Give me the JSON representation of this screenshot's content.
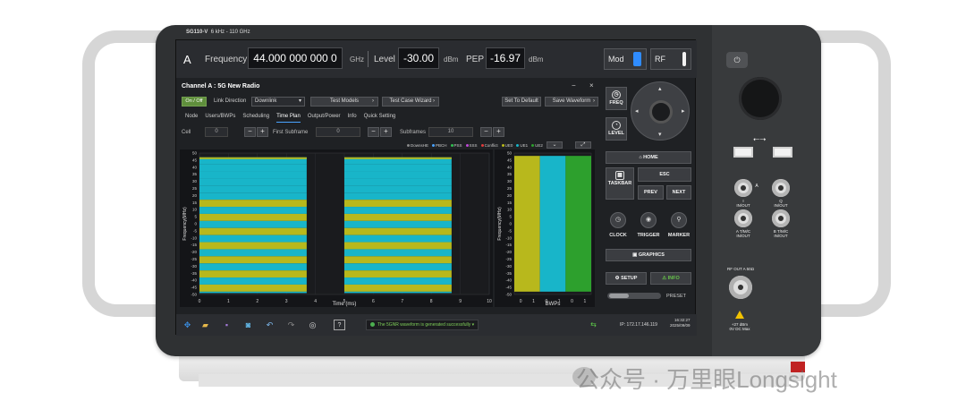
{
  "device": {
    "model": "SG110-V",
    "range": "6 kHz - 110 GHz"
  },
  "topbar": {
    "channel": "A",
    "frequency_label": "Frequency",
    "frequency_value": "44.000 000 000 0",
    "frequency_unit": "GHz",
    "level_label": "Level",
    "level_value": "-30.00",
    "level_unit": "dBm",
    "pep_label": "PEP",
    "pep_value": "-16.97",
    "pep_unit": "dBm",
    "mod_label": "Mod",
    "rf_label": "RF"
  },
  "window": {
    "title": "Channel A : 5G New Radio",
    "minimize": "−",
    "close": "×"
  },
  "controls": {
    "on_off": "On / Off",
    "link_direction_label": "Link Direction",
    "link_direction_value": "Downlink",
    "test_models": "Test Models",
    "test_case_wizard": "Test Case Wizard",
    "set_to_default": "Set To Default",
    "save_waveform": "Save Waveform"
  },
  "tabs": [
    "Node",
    "Users/BWPs",
    "Scheduling",
    "Time Plan",
    "Output/Power",
    "Info",
    "Quick Setting"
  ],
  "active_tab": "Time Plan",
  "row3": {
    "cell_label": "Cell",
    "cell_value": "0",
    "first_subframe_label": "First Subframe",
    "first_subframe_value": "0",
    "subframes_label": "Subframes",
    "subframes_value": "10"
  },
  "legend": [
    {
      "name": "DownsHE",
      "color": "#888888"
    },
    {
      "name": "PBCH",
      "color": "#4aa3ff"
    },
    {
      "name": "PSS",
      "color": "#2fbf4f"
    },
    {
      "name": "SSS",
      "color": "#c049d8"
    },
    {
      "name": "Conflict",
      "color": "#e03c3c"
    },
    {
      "name": "UE0",
      "color": "#b8b81c"
    },
    {
      "name": "UE1",
      "color": "#18b5c9"
    },
    {
      "name": "UE2",
      "color": "#2da02d"
    }
  ],
  "chart_data": [
    {
      "type": "heatmap",
      "title": "",
      "xlabel": "Time (ms)",
      "ylabel": "Frequency(MHz)",
      "xlim": [
        0,
        10
      ],
      "ylim": [
        -50,
        50
      ],
      "x_ticks": [
        "0",
        "1",
        "2",
        "3",
        "4",
        "5",
        "6",
        "7",
        "8",
        "9",
        "10"
      ],
      "y_ticks": [
        "50",
        "45",
        "40",
        "35",
        "30",
        "25",
        "20",
        "15",
        "10",
        "5",
        "0",
        "-5",
        "-10",
        "-15",
        "-20",
        "-25",
        "-30",
        "-35",
        "-40",
        "-45",
        "-50"
      ],
      "blocks": [
        {
          "x_start": 0,
          "x_end": 3.7,
          "y_start": -49,
          "y_end": 47
        },
        {
          "x_start": 5,
          "x_end": 8.7,
          "y_start": -49,
          "y_end": 47
        }
      ],
      "stripe_colors": [
        "#18b5c9",
        "#b8b81c"
      ]
    },
    {
      "type": "bar",
      "xlabel": "BWPs",
      "ylabel": "Frequency(MHz)",
      "ylim": [
        -50,
        50
      ],
      "x_ticks": [
        "0",
        "1",
        "0",
        "1",
        "0",
        "1"
      ],
      "y_ticks": [
        "50",
        "45",
        "40",
        "35",
        "30",
        "25",
        "20",
        "15",
        "10",
        "5",
        "0",
        "-5",
        "-10",
        "-15",
        "-20",
        "-25",
        "-30",
        "-35",
        "-40",
        "-45",
        "-50"
      ],
      "series": [
        {
          "name": "UE0",
          "color": "#b8b81c",
          "range": [
            -48,
            48
          ]
        },
        {
          "name": "UE1",
          "color": "#18b5c9",
          "range": [
            -48,
            48
          ]
        },
        {
          "name": "UE2",
          "color": "#2da02d",
          "range": [
            -48,
            48
          ]
        }
      ]
    }
  ],
  "softkeys": {
    "freq": "FREQ",
    "level": "LEVEL",
    "home": "HOME",
    "esc": "ESC",
    "taskbar": "TASKBAR",
    "prev": "PREV",
    "next": "NEXT",
    "clock": "CLOCK",
    "trigger": "TRIGGER",
    "marker": "MARKER",
    "graphics": "GRAPHICS",
    "setup": "SETUP",
    "info": "INFO",
    "preset": "PRESET"
  },
  "taskbar": {
    "status": "The 5GNR waveform is generated successfully",
    "ip": "IP: 172.17.146.119",
    "time": "16:32:27",
    "date": "2025/09/09"
  },
  "panel": {
    "i_label": "I",
    "i_sub": "IN/OUT",
    "q_label": "Q",
    "q_sub": "IN/OUT",
    "a_label": "A",
    "atm_label": "A T/M/C",
    "atm_sub": "IN/OUT",
    "btm_label": "B T/M/C",
    "btm_sub": "IN/OUT",
    "rfout_label": "RF OUT A 50Ω",
    "warn1": "+27 dBm",
    "warn2": "0V DC Max"
  },
  "watermark": "公众号 · 万里眼Longsight"
}
